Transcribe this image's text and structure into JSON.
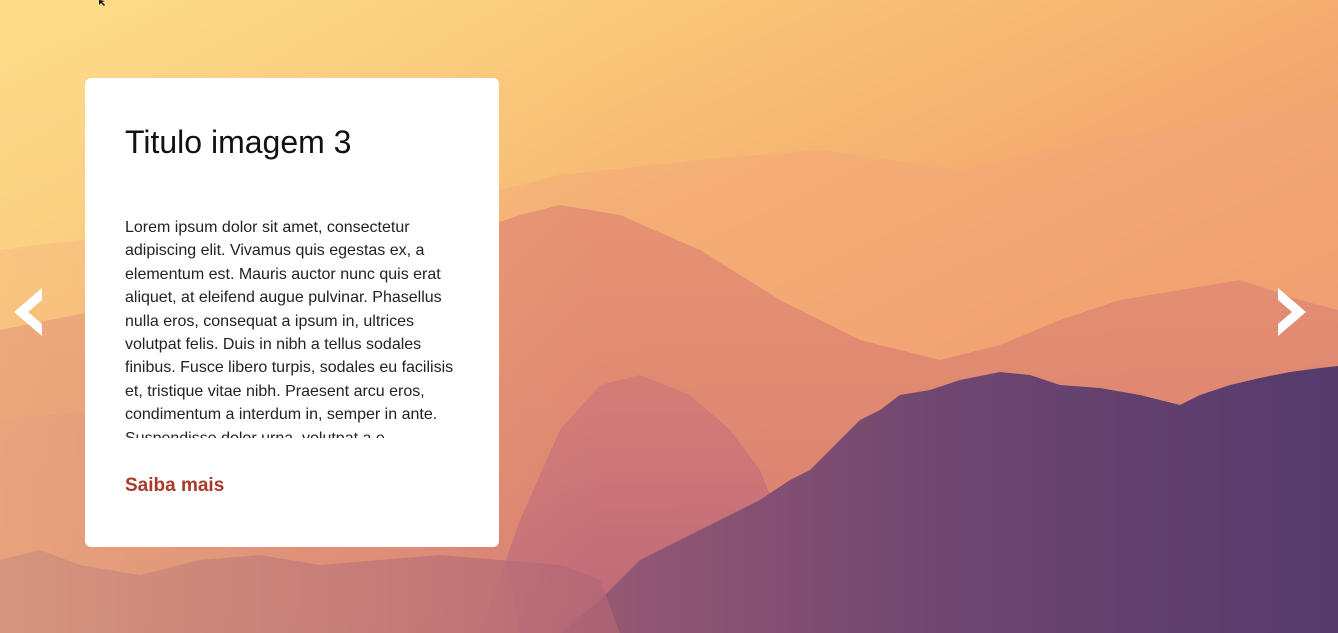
{
  "slide": {
    "title": "Titulo imagem 3",
    "description": "Lorem ipsum dolor sit amet, consectetur adipiscing elit. Vivamus quis egestas ex, a elementum est. Mauris auctor nunc quis erat aliquet, at eleifend augue pulvinar. Phasellus nulla eros, consequat a ipsum in, ultrices volutpat felis. Duis in nibh a tellus sodales finibus. Fusce libero turpis, sodales eu facilisis et, tristique vitae nibh. Praesent arcu eros, condimentum a interdum in, semper in ante. Suspendisse dolor urna, volutpat a e",
    "link_label": "Saiba mais"
  },
  "controls": {
    "prev_icon": "chevron-left-icon",
    "next_icon": "chevron-right-icon"
  },
  "colors": {
    "card_background": "#ffffff",
    "link": "#a8392b",
    "arrow": "#ffffff",
    "sky_light": "#fcd97b",
    "sky_warm": "#ef9a6c",
    "hills_shadow": "#6e4872"
  }
}
